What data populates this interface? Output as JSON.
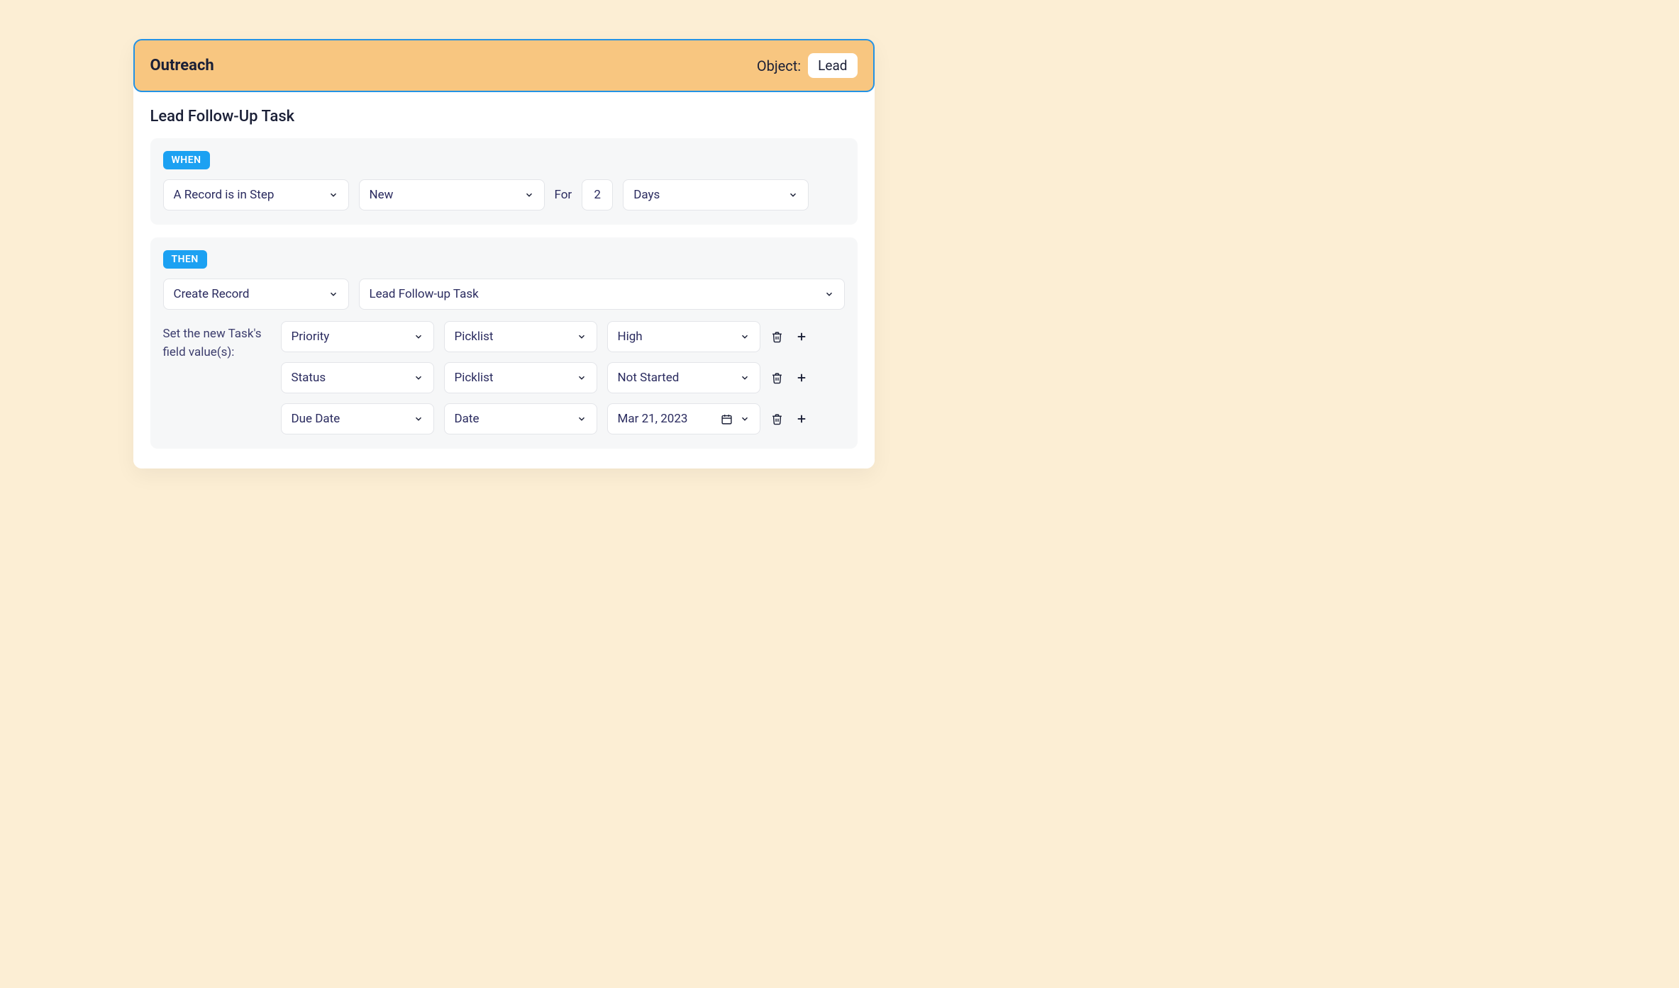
{
  "header": {
    "title": "Outreach",
    "object_label": "Object:",
    "object_value": "Lead"
  },
  "section_title": "Lead Follow-Up Task",
  "when": {
    "tag": "WHEN",
    "trigger": "A Record is in Step",
    "step": "New",
    "for_label": "For",
    "for_value": "2",
    "unit": "Days"
  },
  "then": {
    "tag": "THEN",
    "action": "Create Record",
    "record_type": "Lead Follow-up Task",
    "fields_label": "Set the new Task's field value(s):",
    "rows": [
      {
        "field": "Priority",
        "type": "Picklist",
        "value": "High",
        "has_calendar": false
      },
      {
        "field": "Status",
        "type": "Picklist",
        "value": "Not Started",
        "has_calendar": false
      },
      {
        "field": "Due Date",
        "type": "Date",
        "value": "Mar 21, 2023",
        "has_calendar": true
      }
    ]
  }
}
